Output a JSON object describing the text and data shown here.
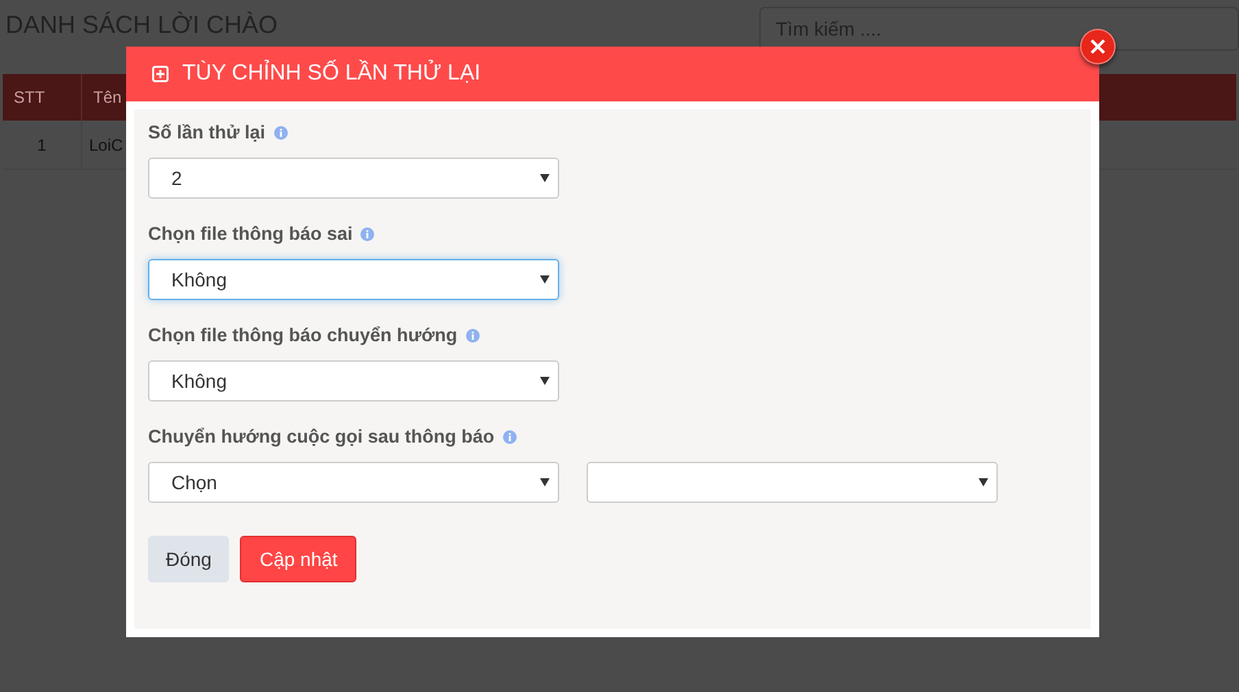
{
  "page": {
    "title": "DANH SÁCH LỜI CHÀO",
    "search": {
      "placeholder": "Tìm kiếm ...."
    }
  },
  "table": {
    "columns": [
      "STT",
      "Tên"
    ],
    "rows": [
      [
        "1",
        "LoiC"
      ]
    ]
  },
  "dialog": {
    "title": "TÙY CHỈNH SỐ LẦN THỬ LẠI",
    "fields": [
      {
        "label": "Số lần thử lại",
        "selects": [
          {
            "value": "2",
            "focused": false
          }
        ]
      },
      {
        "label": "Chọn file thông báo sai",
        "selects": [
          {
            "value": "Không",
            "focused": true
          }
        ]
      },
      {
        "label": "Chọn file thông báo chuyển hướng",
        "selects": [
          {
            "value": "Không",
            "focused": false
          }
        ]
      },
      {
        "label": "Chuyển hướng cuộc gọi sau thông báo",
        "selects": [
          {
            "value": "Chọn",
            "focused": false
          },
          {
            "focused": false
          }
        ]
      }
    ],
    "buttons": [
      {
        "label": "Đóng",
        "kind": "secondary"
      },
      {
        "label": "Cập nhật",
        "kind": "primary"
      }
    ]
  }
}
